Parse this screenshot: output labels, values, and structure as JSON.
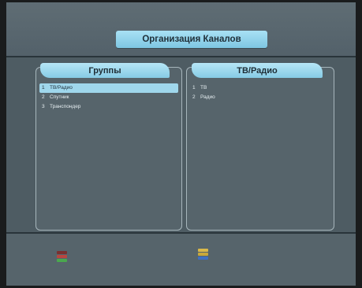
{
  "header": {
    "title": "Организация Каналов"
  },
  "panels": {
    "groups": {
      "title": "Группы",
      "items": [
        {
          "num": "1",
          "label": "ТВ/Радио"
        },
        {
          "num": "2",
          "label": "Спутник"
        },
        {
          "num": "3",
          "label": "Транспондер"
        }
      ]
    },
    "tvradio": {
      "title": "ТВ/Радио",
      "items": [
        {
          "num": "1",
          "label": "ТВ"
        },
        {
          "num": "2",
          "label": "Радио"
        }
      ]
    }
  },
  "footer": {
    "legend_red_green": {
      "icon": "red-green-buttons-icon",
      "colors": [
        "#b8463f",
        "#4aa84e"
      ]
    },
    "legend_yellow_blue": {
      "icon": "yellow-blue-buttons-icon",
      "colors": [
        "#d9b84a",
        "#3f6fc0"
      ]
    }
  },
  "colors": {
    "accent": "#9fd7ec",
    "background": "#56646b"
  }
}
